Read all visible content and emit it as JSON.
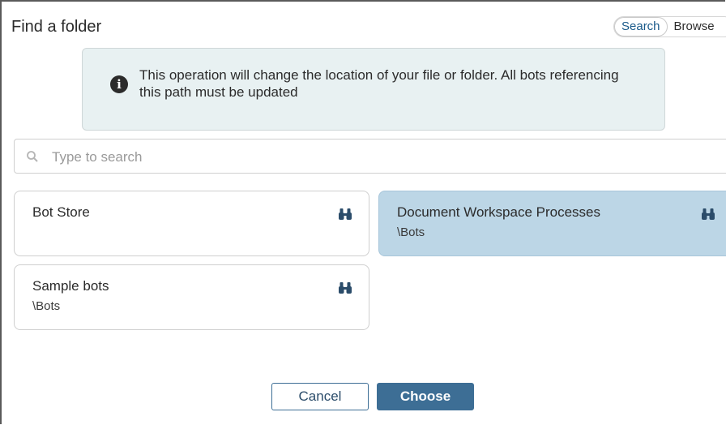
{
  "dialog": {
    "title": "Find a folder",
    "toggle": {
      "search_label": "Search",
      "browse_label": "Browse",
      "active": "Search"
    },
    "notice": {
      "icon": "info-icon",
      "message": "This operation will change the location of your file or folder. All bots referencing this path must be updated"
    },
    "search": {
      "placeholder": "Type to search",
      "value": "",
      "icon": "search-icon"
    },
    "folders": [
      {
        "name": "Bot Store",
        "path": "",
        "selected": false,
        "icon": "binoculars-icon"
      },
      {
        "name": "Document Workspace Processes",
        "path": "\\Bots",
        "selected": true,
        "icon": "binoculars-icon"
      },
      {
        "name": "Sample bots",
        "path": "\\Bots",
        "selected": false,
        "icon": "binoculars-icon"
      }
    ],
    "buttons": {
      "cancel_label": "Cancel",
      "choose_label": "Choose"
    }
  },
  "colors": {
    "accent": "#3d6e95",
    "selected_card": "#bcd6e6",
    "notice_bg": "#e8f1f2"
  }
}
